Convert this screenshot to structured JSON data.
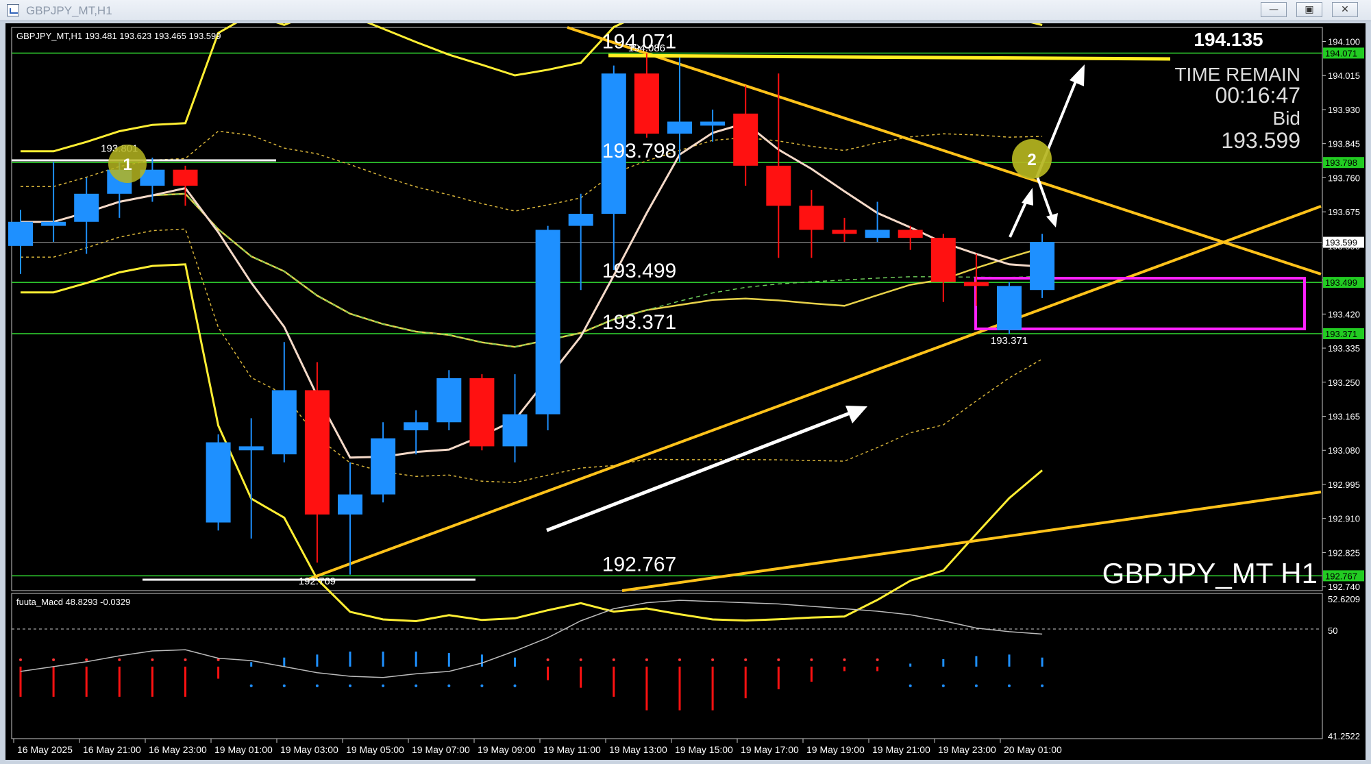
{
  "window": {
    "title": "GBPJPY_MT,H1",
    "minimize_glyph": "—",
    "maximize_glyph": "▣",
    "close_glyph": "✕"
  },
  "chart_header": "GBPJPY_MT,H1  193.481 193.623 193.465 193.599",
  "big_price": "194.135",
  "time_remain": {
    "label": "TIME REMAIN",
    "value": "00:16:47",
    "bid_label": "Bid",
    "bid_value": "193.599"
  },
  "watermark": "GBPJPY_MT H1",
  "markers": [
    "1",
    "2"
  ],
  "colors": {
    "bull": "#1e90ff",
    "bear": "#ff1111",
    "band": "#ffee33",
    "trend": "#ffc21a",
    "level": "#33dd33",
    "zone": "#ff22ff",
    "arrow": "#ffffff",
    "marker": "#b5b520"
  },
  "chart_data": {
    "type": "candlestick",
    "symbol": "GBPJPY_MT",
    "timeframe": "H1",
    "ohlc": [
      {
        "o": 193.59,
        "h": 193.68,
        "l": 193.52,
        "c": 193.65
      },
      {
        "o": 193.64,
        "h": 193.8,
        "l": 193.6,
        "c": 193.65
      },
      {
        "o": 193.65,
        "h": 193.76,
        "l": 193.57,
        "c": 193.72
      },
      {
        "o": 193.72,
        "h": 193.8,
        "l": 193.66,
        "c": 193.78
      },
      {
        "o": 193.74,
        "h": 193.81,
        "l": 193.7,
        "c": 193.78
      },
      {
        "o": 193.78,
        "h": 193.79,
        "l": 193.69,
        "c": 193.74
      },
      {
        "o": 192.9,
        "h": 193.12,
        "l": 192.88,
        "c": 193.1
      },
      {
        "o": 193.08,
        "h": 193.16,
        "l": 192.86,
        "c": 193.09
      },
      {
        "o": 193.07,
        "h": 193.35,
        "l": 193.05,
        "c": 193.23
      },
      {
        "o": 193.23,
        "h": 193.3,
        "l": 192.8,
        "c": 192.92
      },
      {
        "o": 192.92,
        "h": 193.05,
        "l": 192.77,
        "c": 192.97
      },
      {
        "o": 192.97,
        "h": 193.15,
        "l": 192.95,
        "c": 193.11
      },
      {
        "o": 193.13,
        "h": 193.18,
        "l": 193.07,
        "c": 193.15
      },
      {
        "o": 193.15,
        "h": 193.28,
        "l": 193.13,
        "c": 193.26
      },
      {
        "o": 193.26,
        "h": 193.27,
        "l": 193.08,
        "c": 193.09
      },
      {
        "o": 193.09,
        "h": 193.27,
        "l": 193.05,
        "c": 193.17
      },
      {
        "o": 193.17,
        "h": 193.64,
        "l": 193.13,
        "c": 193.63
      },
      {
        "o": 193.64,
        "h": 193.72,
        "l": 193.48,
        "c": 193.67
      },
      {
        "o": 193.67,
        "h": 194.04,
        "l": 193.53,
        "c": 194.02
      },
      {
        "o": 194.02,
        "h": 194.07,
        "l": 193.86,
        "c": 193.87
      },
      {
        "o": 193.87,
        "h": 194.06,
        "l": 193.8,
        "c": 193.9
      },
      {
        "o": 193.89,
        "h": 193.93,
        "l": 193.85,
        "c": 193.9
      },
      {
        "o": 193.92,
        "h": 193.99,
        "l": 193.74,
        "c": 193.79
      },
      {
        "o": 193.79,
        "h": 194.02,
        "l": 193.56,
        "c": 193.69
      },
      {
        "o": 193.69,
        "h": 193.73,
        "l": 193.56,
        "c": 193.63
      },
      {
        "o": 193.63,
        "h": 193.66,
        "l": 193.6,
        "c": 193.62
      },
      {
        "o": 193.61,
        "h": 193.7,
        "l": 193.6,
        "c": 193.63
      },
      {
        "o": 193.63,
        "h": 193.64,
        "l": 193.58,
        "c": 193.61
      },
      {
        "o": 193.61,
        "h": 193.62,
        "l": 193.45,
        "c": 193.5
      },
      {
        "o": 193.5,
        "h": 193.57,
        "l": 193.44,
        "c": 193.49
      },
      {
        "o": 193.38,
        "h": 193.5,
        "l": 193.37,
        "c": 193.49
      },
      {
        "o": 193.48,
        "h": 193.62,
        "l": 193.46,
        "c": 193.6
      }
    ],
    "price_axis": [
      "194.100",
      "194.015",
      "193.930",
      "193.845",
      "193.760",
      "193.675",
      "193.590",
      "193.505",
      "193.420",
      "193.335",
      "193.250",
      "193.165",
      "193.080",
      "192.995",
      "192.910",
      "192.825",
      "192.740"
    ],
    "price_ticks": [
      194.1,
      194.015,
      193.93,
      193.845,
      193.76,
      193.675,
      193.59,
      193.505,
      193.42,
      193.335,
      193.25,
      193.165,
      193.08,
      192.995,
      192.91,
      192.825,
      192.74
    ],
    "ylim": [
      192.73,
      194.135
    ],
    "levels": [
      {
        "price": 194.071,
        "label": "194.071",
        "tag": "194.071",
        "color": "#33dd33"
      },
      {
        "price": 193.798,
        "label": "193.798",
        "tag": "193.798",
        "color": "#33dd33"
      },
      {
        "price": 193.499,
        "label": "193.499",
        "tag": "193.499",
        "color": "#33dd33"
      },
      {
        "price": 193.371,
        "label": "193.371",
        "tag": "193.371",
        "color": "#33dd33"
      },
      {
        "price": 192.767,
        "label": "192.767",
        "tag": "192.767",
        "color": "#33dd33"
      }
    ],
    "current_price": {
      "price": 193.599,
      "tag": "193.599"
    },
    "point_labels": [
      {
        "text": "193.801",
        "bar": 3,
        "price": 193.825
      },
      {
        "text": "193.371",
        "bar": 30,
        "price": 193.345
      },
      {
        "text": "192.769",
        "bar": 9,
        "price": 192.745
      },
      {
        "text": "194.086",
        "bar": 19,
        "price": 194.075
      }
    ],
    "time_axis": [
      "16 May 2025",
      "16 May 21:00",
      "16 May 23:00",
      "19 May 01:00",
      "19 May 03:00",
      "19 May 05:00",
      "19 May 07:00",
      "19 May 09:00",
      "19 May 11:00",
      "19 May 13:00",
      "19 May 15:00",
      "19 May 17:00",
      "19 May 19:00",
      "19 May 21:00",
      "19 May 23:00",
      "20 May 01:00"
    ],
    "indicator": {
      "name": "fuuta_Macd",
      "header": "fuuta_Macd 48.8293  -0.0329",
      "values": [
        48.8293,
        -0.0329
      ],
      "axis": [
        "52.6209",
        "50",
        "41.2522"
      ],
      "ylim": [
        41.2522,
        52.6209
      ],
      "hist": [
        -2,
        -2,
        -2,
        -2,
        -2,
        -2,
        -0.8,
        0.3,
        0.6,
        0.8,
        1.0,
        1.0,
        1.0,
        0.9,
        0.8,
        0.6,
        -0.9,
        -1.4,
        -2,
        -2.9,
        -2.9,
        -2.9,
        -2.1,
        -1.5,
        -1.0,
        -0.3,
        -0.3,
        0.2,
        0.5,
        0.7,
        0.8,
        0.6
      ],
      "signal": [
        46.6,
        47.0,
        47.4,
        47.9,
        48.3,
        48.4,
        47.7,
        47.5,
        47.0,
        46.5,
        46.2,
        46.1,
        46.4,
        46.6,
        47.3,
        48.3,
        49.4,
        50.8,
        51.8,
        52.3,
        52.5,
        52.4,
        52.3,
        52.2,
        52.0,
        51.8,
        51.6,
        51.3,
        50.8,
        50.2,
        49.9,
        49.7
      ]
    }
  }
}
